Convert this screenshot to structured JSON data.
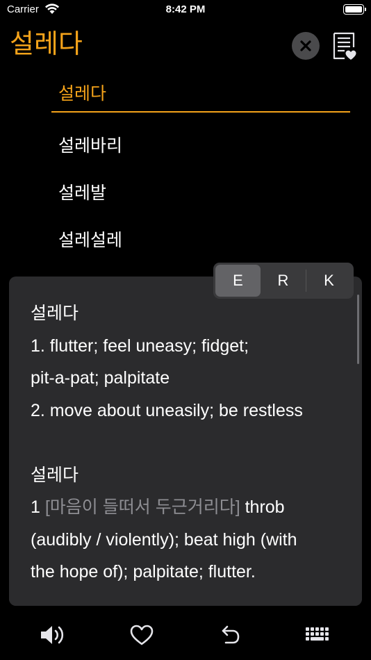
{
  "status_bar": {
    "carrier": "Carrier",
    "time": "8:42 PM"
  },
  "header": {
    "search_term": "설레다"
  },
  "suggestions": [
    "설레다",
    "설레바리",
    "설레발",
    "설레설레"
  ],
  "language_tabs": [
    "E",
    "R",
    "K"
  ],
  "selected_language": "E",
  "entries": {
    "first_headword": "설레다",
    "first_lines": [
      "1. flutter; feel uneasy; fidget;",
      "pit-a-pat; palpitate",
      "2. move about uneasily; be restless"
    ],
    "second_headword": "설레다",
    "second_num": "1 ",
    "second_korean": "[마음이 들떠서 두근거리다]",
    "second_rest": " throb",
    "second_lines": [
      "(audibly / violently); beat high (with",
      "the hope of); palpitate; flutter."
    ]
  },
  "toolbar": [
    "speaker-icon",
    "heart-icon",
    "undo-icon",
    "keyboard-icon"
  ],
  "colors": {
    "accent": "#f5a31a",
    "panel": "#2b2b2d",
    "muted": "#8e8e93"
  }
}
